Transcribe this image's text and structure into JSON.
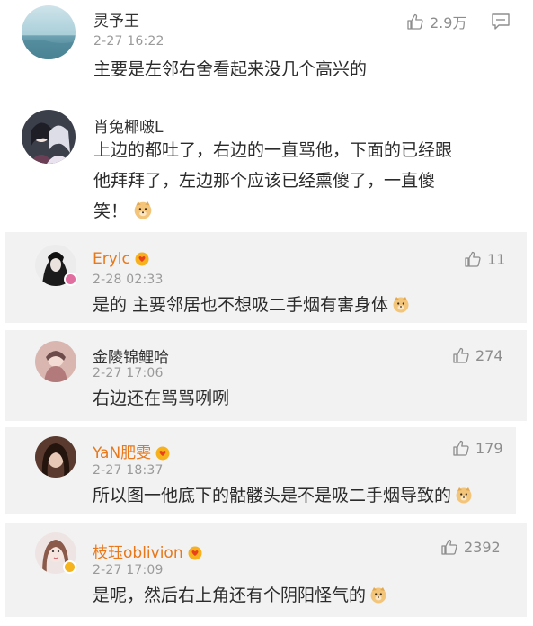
{
  "top_comments": [
    {
      "username": "灵予王",
      "date": "2-27 16:22",
      "likes": "2.9万",
      "text": "主要是左邻右舍看起来没几个高兴的",
      "avatar_icon": "sea-avatar"
    },
    {
      "username": "肖兔椰啵L",
      "text_lines": [
        "上边的都吐了，右边的一直骂他，下面的已经跟",
        "他拜拜了，左边那个应该已经熏傻了，一直傻",
        "笑！"
      ],
      "avatar_icon": "anime-couple-avatar"
    }
  ],
  "replies": [
    {
      "username": "Erylc",
      "date": "2-28 02:33",
      "likes": "11",
      "text": "是的 主要邻居也不想吸二手烟有害身体"
    },
    {
      "username": "金陵锦鲤哈",
      "date": "2-27 17:06",
      "likes": "274",
      "text": "右边还在骂骂咧咧"
    },
    {
      "username": "YaN肥雯",
      "date": "2-27 18:37",
      "likes": "179",
      "text": "所以图一他底下的骷髅头是不是吸二手烟导致的"
    },
    {
      "username": "枝珏oblivion",
      "date": "2-27 17:09",
      "likes": "2392",
      "text": "是呢，然后右上角还有个阴阳怪气的"
    }
  ],
  "colors": {
    "reply_bg": "#f2f2f2",
    "vip_name": "#e8781a",
    "meta_gray": "#9a9a9a"
  }
}
